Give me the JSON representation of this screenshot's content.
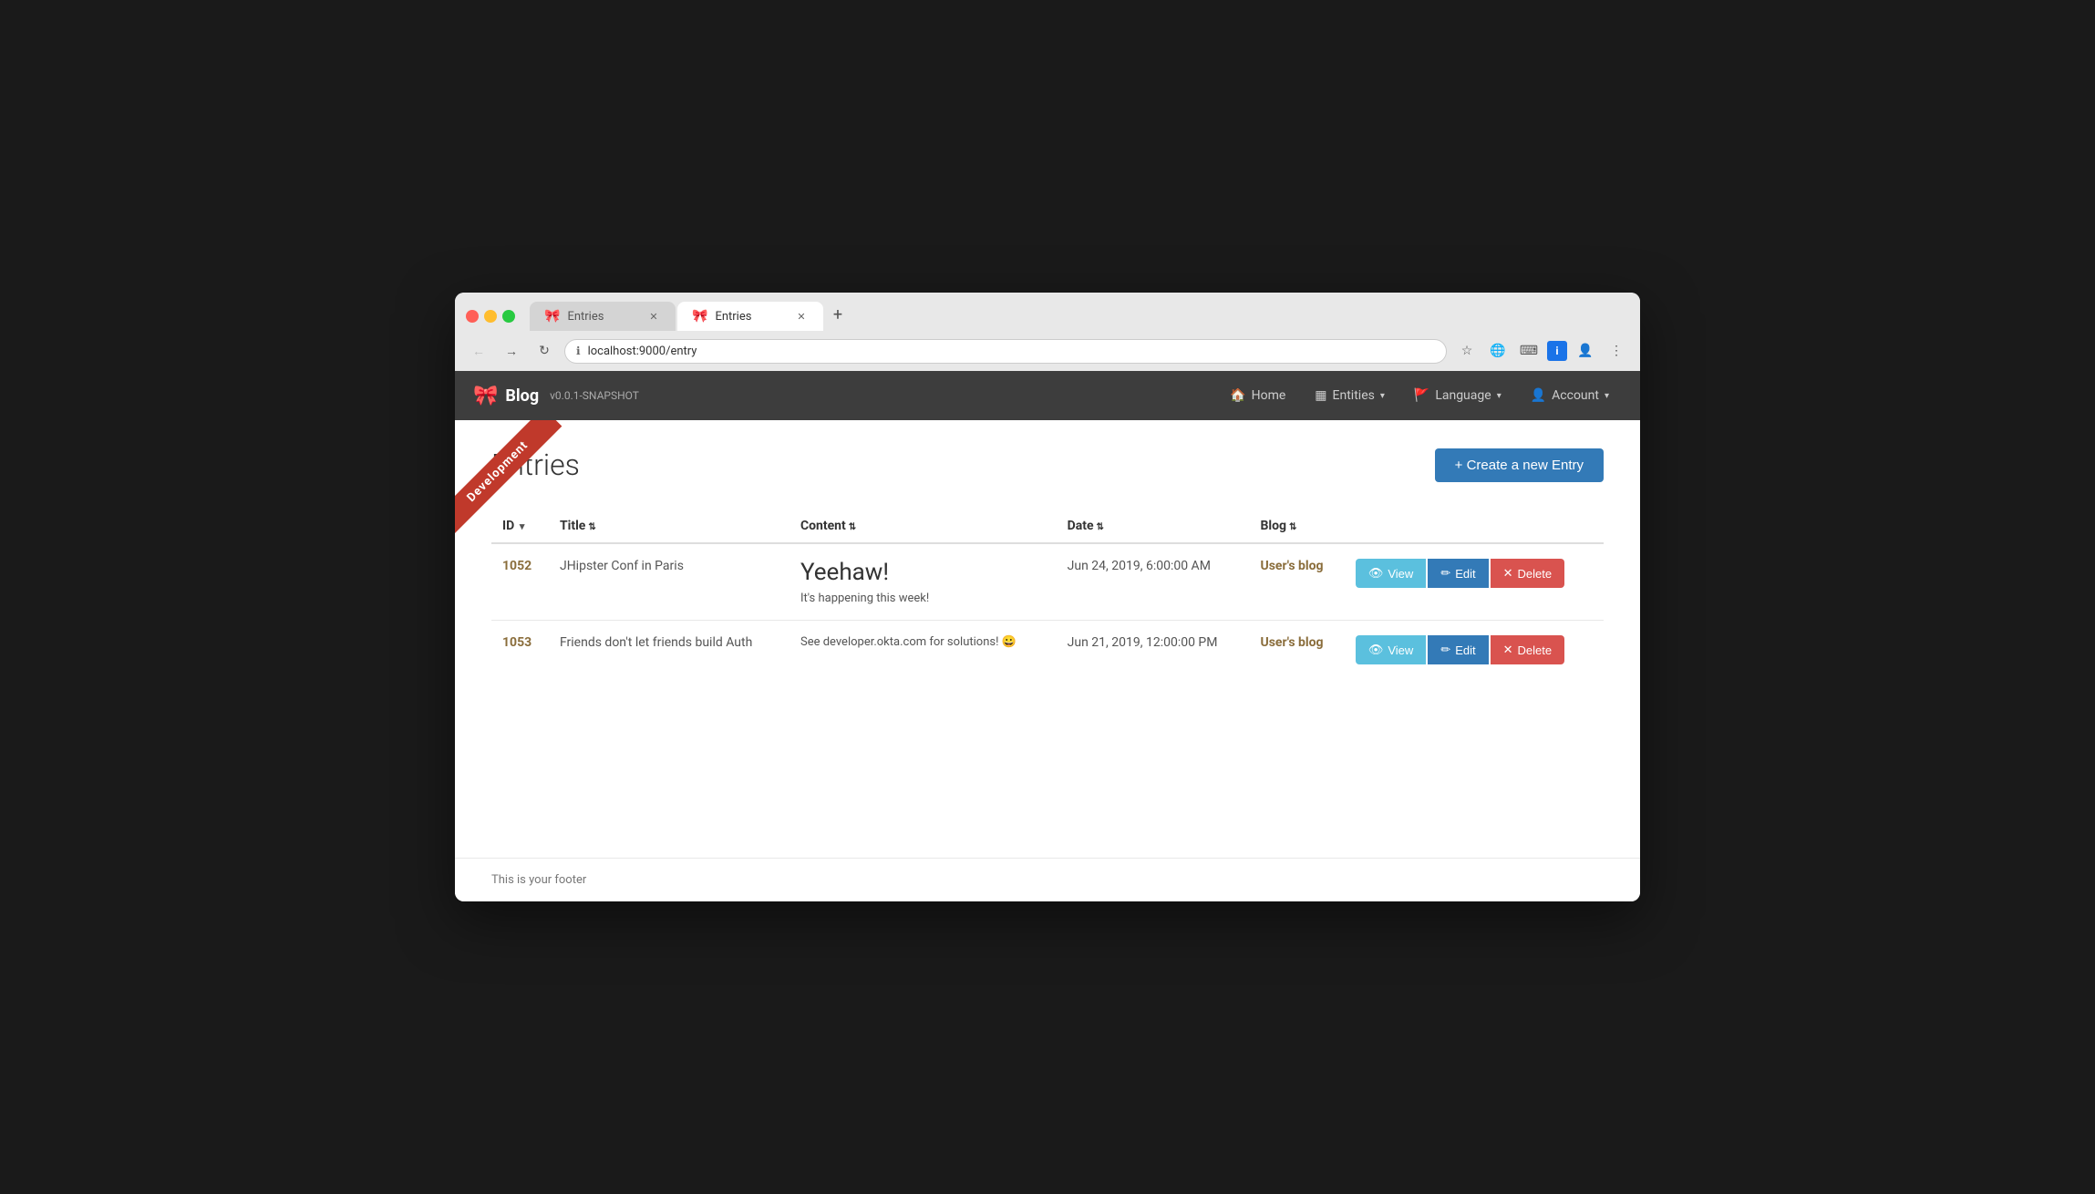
{
  "browser": {
    "tabs": [
      {
        "id": "tab1",
        "label": "Entries",
        "active": false,
        "icon": "🎀"
      },
      {
        "id": "tab2",
        "label": "Entries",
        "active": true,
        "icon": "🎀"
      }
    ],
    "address": "localhost:9000/entry",
    "new_tab_label": "+"
  },
  "app": {
    "brand": {
      "icon": "🎀",
      "name": "Blog",
      "version": "v0.0.1-SNAPSHOT"
    },
    "ribbon": {
      "text": "Development"
    },
    "nav": {
      "home_label": "Home",
      "entities_label": "Entities",
      "language_label": "Language",
      "account_label": "Account"
    },
    "page": {
      "title": "Entries",
      "create_button": "+ Create a new Entry"
    },
    "table": {
      "columns": [
        {
          "key": "id",
          "label": "ID",
          "sortable": true,
          "sort_type": "down"
        },
        {
          "key": "title",
          "label": "Title",
          "sortable": true
        },
        {
          "key": "content",
          "label": "Content",
          "sortable": true
        },
        {
          "key": "date",
          "label": "Date",
          "sortable": true
        },
        {
          "key": "blog",
          "label": "Blog",
          "sortable": true
        }
      ],
      "rows": [
        {
          "id": "1052",
          "title": "JHipster Conf in Paris",
          "content_large": "Yeehaw!",
          "content_small": "It's happening this week!",
          "date": "Jun 24, 2019, 6:00:00 AM",
          "blog": "User's blog"
        },
        {
          "id": "1053",
          "title": "Friends don't let friends build Auth",
          "content_large": null,
          "content_small": "See developer.okta.com for solutions! 😀",
          "date": "Jun 21, 2019, 12:00:00 PM",
          "blog": "User's blog"
        }
      ],
      "action_view": "View",
      "action_edit": "Edit",
      "action_delete": "Delete"
    },
    "footer": {
      "text": "This is your footer"
    }
  }
}
